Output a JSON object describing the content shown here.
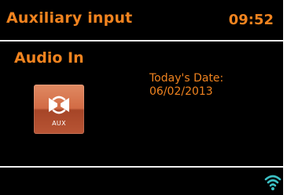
{
  "colors": {
    "background": "#000000",
    "accent": "#f0831f",
    "divider": "#f0f0f0",
    "aux_tile": "#c85a36",
    "wifi": "#3cc0c4"
  },
  "header": {
    "title": "Auxiliary input",
    "time": "09:52"
  },
  "main": {
    "mode_label": "Audio In",
    "aux_icon": {
      "icon": "aux-input-icon",
      "caption": "AUX"
    },
    "date": {
      "label": "Today's Date:",
      "value": "06/02/2013"
    }
  },
  "status_bar": {
    "wifi_icon": "wifi-signal-icon"
  }
}
